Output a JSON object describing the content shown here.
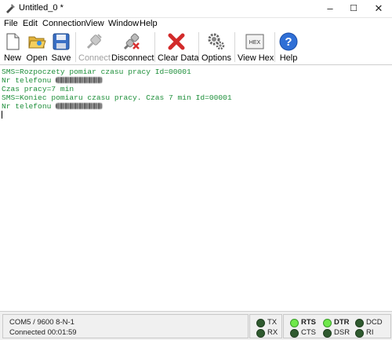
{
  "window": {
    "title": "Untitled_0 *",
    "controls": [
      "–",
      "☐",
      "✕"
    ]
  },
  "menu": {
    "items": [
      "File",
      "Edit",
      "Connection",
      "View",
      "Window",
      "Help"
    ]
  },
  "toolbar": {
    "buttons": [
      {
        "label": "New",
        "icon": "new-document-icon",
        "enabled": true
      },
      {
        "label": "Open",
        "icon": "open-folder-icon",
        "enabled": true
      },
      {
        "label": "Save",
        "icon": "save-disk-icon",
        "enabled": true
      },
      {
        "label": "Connect",
        "icon": "connect-plug-icon",
        "enabled": false
      },
      {
        "label": "Disconnect",
        "icon": "disconnect-plug-icon",
        "enabled": true
      },
      {
        "label": "Clear Data",
        "icon": "clear-x-icon",
        "enabled": true
      },
      {
        "label": "Options",
        "icon": "gears-icon",
        "enabled": true
      },
      {
        "label": "View Hex",
        "icon": "hex-icon",
        "enabled": true
      },
      {
        "label": "Help",
        "icon": "help-icon",
        "enabled": true
      }
    ],
    "hex_text": "HEX",
    "help_glyph": "?"
  },
  "terminal": {
    "text_color": "#1e8f3a",
    "lines": [
      {
        "text": "SMS=Rozpoczety pomiar czasu pracy Id=00001"
      },
      {
        "text": "Nr telefonu ",
        "redacted": true
      },
      {
        "text": "Czas pracy=7 min"
      },
      {
        "text": "SMS=Koniec pomiaru czasu pracy. Czas 7 min Id=00001"
      },
      {
        "text": "Nr telefonu ",
        "redacted": true
      }
    ]
  },
  "status": {
    "port": "COM5 / 9600 8-N-1",
    "connection": "Connected 00:01:59",
    "leds": [
      {
        "label": "TX",
        "on": false,
        "bold": false
      },
      {
        "label": "RX",
        "on": false,
        "bold": false
      },
      {
        "label": "RTS",
        "on": true,
        "bold": true
      },
      {
        "label": "CTS",
        "on": false,
        "bold": false
      },
      {
        "label": "DTR",
        "on": true,
        "bold": true
      },
      {
        "label": "DSR",
        "on": false,
        "bold": false
      },
      {
        "label": "DCD",
        "on": false,
        "bold": false
      },
      {
        "label": "RI",
        "on": false,
        "bold": false
      }
    ]
  }
}
